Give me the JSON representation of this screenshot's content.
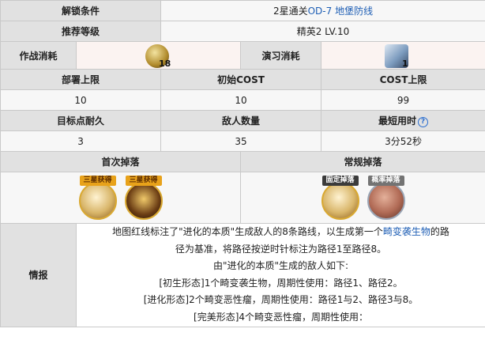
{
  "rows": {
    "unlock": {
      "label": "解锁条件",
      "prefix": "2星通关",
      "link1": "OD-7",
      "link2": "地堡防线"
    },
    "recommend": {
      "label": "推荐等级",
      "value": "精英2 LV.10"
    },
    "costs": {
      "combat_label": "作战消耗",
      "combat_count": "18",
      "exercise_label": "演习消耗",
      "exercise_count": "1"
    },
    "stats_header": {
      "deploy": "部署上限",
      "init_cost": "初始COST",
      "cost_max": "COST上限"
    },
    "stats_values": {
      "deploy": "10",
      "init_cost": "10",
      "cost_max": "99"
    },
    "stats2_header": {
      "durability": "目标点耐久",
      "enemies": "敌人数量",
      "fastest": "最短用时",
      "help": "?"
    },
    "stats2_values": {
      "durability": "3",
      "enemies": "35",
      "fastest": "3分52秒"
    },
    "drops_header": {
      "first": "首次掉落",
      "regular": "常规掉落"
    },
    "drops": {
      "first": [
        {
          "tag": "三星获得",
          "icon": "material-box-icon"
        },
        {
          "tag": "三星获得",
          "icon": "orundum-icon"
        }
      ],
      "regular": [
        {
          "tag": "固定掉落",
          "icon": "material-box-icon"
        },
        {
          "tag": "概率掉落",
          "icon": "brick-icon"
        }
      ]
    },
    "info": {
      "label": "情报",
      "line1_a": "地图红线标注了\"进化的本质\"生成敌人的8条路线，以生成第一个",
      "line1_link": "畸变袭生物",
      "line1_b": "的路",
      "line2": "径为基准，将路径按逆时针标注为路径1至路径8。",
      "line3": "由\"进化的本质\"生成的敌人如下:",
      "line4": "[初生形态]1个畸变袭生物，周期性使用：路径1、路径2。",
      "line5": "[进化形态]2个畸变恶性瘤，周期性使用：路径1与2、路径3与8。",
      "line6": "[完美形态]4个畸变恶性瘤，周期性使用："
    }
  },
  "colors": {
    "header_bg": "#e1e1e1",
    "value_bg": "#f7f7f7",
    "link": "#1f5fb5",
    "cost_bg": "#fbf3f1"
  }
}
